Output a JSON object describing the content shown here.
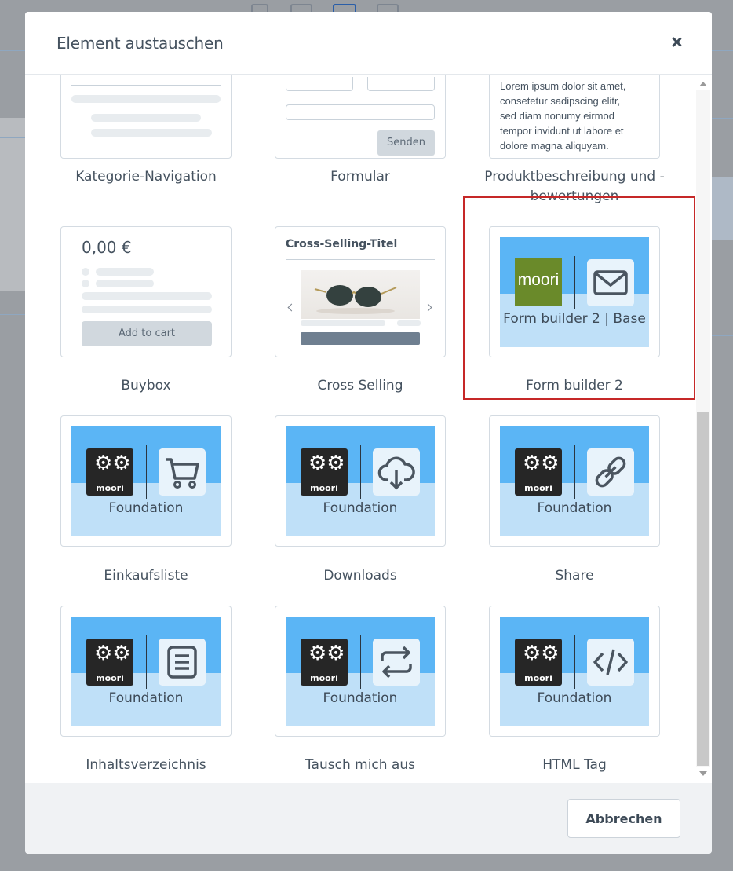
{
  "modal": {
    "title": "Element austauschen",
    "cancel_label": "Abbrechen"
  },
  "partial_row": [
    {
      "label": "Kategorie-Navigation"
    },
    {
      "label": "Formular",
      "submit_label": "Senden"
    },
    {
      "label": "Produktbeschreibung und -\nbewertungen",
      "label_line1": "Produktbeschreibung und -",
      "label_line2": "bewertungen",
      "lorem": [
        "Lorem ipsum dolor sit amet,",
        "consetetur sadipscing elitr,",
        "sed diam nonumy eirmod",
        "tempor invidunt ut labore et",
        "dolore magna aliquyam."
      ]
    }
  ],
  "row2": [
    {
      "label": "Buybox",
      "price": "0,00 €",
      "cart_label": "Add to cart"
    },
    {
      "label": "Cross Selling",
      "preview_title": "Cross-Selling-Titel"
    },
    {
      "label": "Form builder 2",
      "logo_text": "moori",
      "caption": "Form builder 2 | Base",
      "selected": true
    }
  ],
  "foundation_cards": [
    {
      "label": "Einkaufsliste",
      "caption": "Foundation",
      "logo_text": "moori",
      "icon": "cart-icon"
    },
    {
      "label": "Downloads",
      "caption": "Foundation",
      "logo_text": "moori",
      "icon": "cloud-download-icon"
    },
    {
      "label": "Share",
      "caption": "Foundation",
      "logo_text": "moori",
      "icon": "link-icon"
    },
    {
      "label": "Inhaltsverzeichnis",
      "caption": "Foundation",
      "logo_text": "moori",
      "icon": "document-icon"
    },
    {
      "label": "Tausch mich aus",
      "caption": "Foundation",
      "logo_text": "moori",
      "icon": "swap-icon"
    },
    {
      "label": "HTML Tag",
      "caption": "Foundation",
      "logo_text": "moori",
      "icon": "code-icon"
    }
  ],
  "colors": {
    "highlight": "#c62828",
    "tile_sky": "#5bb5f5",
    "tile_ground": "#bfe0f8",
    "moori_green": "#6a8a2a"
  }
}
